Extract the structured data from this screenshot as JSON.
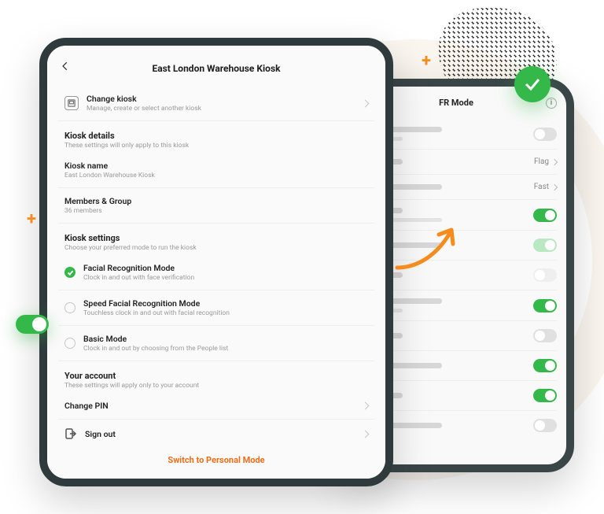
{
  "colors": {
    "accent": "#f06d1a",
    "success": "#35b84a"
  },
  "front": {
    "title": "East London Warehouse Kiosk",
    "changeKiosk": {
      "label": "Change kiosk",
      "sub": "Manage, create or select another kiosk"
    },
    "sections": {
      "details": {
        "title": "Kiosk details",
        "sub": "These settings will only apply to this kiosk"
      },
      "settings": {
        "title": "Kiosk settings",
        "sub": "Choose your preferred mode to run the kiosk"
      },
      "account": {
        "title": "Your account",
        "sub": "These settings will apply only to your account"
      }
    },
    "kioskName": {
      "label": "Kiosk name",
      "value": "East London Warehouse Kiosk"
    },
    "members": {
      "label": "Members & Group",
      "value": "36 members"
    },
    "modes": [
      {
        "label": "Facial Recognition Mode",
        "sub": "Clock in and out with face verification",
        "selected": true
      },
      {
        "label": "Speed Facial Recognition Mode",
        "sub": "Touchless clock in and out with facial recognition",
        "selected": false
      },
      {
        "label": "Basic Mode",
        "sub": "Clock in and out by choosing from the People list",
        "selected": false
      }
    ],
    "changePin": {
      "label": "Change PIN"
    },
    "signOut": {
      "label": "Sign out"
    },
    "footerButton": "Switch to Personal Mode"
  },
  "back": {
    "title": "FR Mode",
    "rows": [
      {
        "type": "toggle",
        "on": false
      },
      {
        "type": "nav",
        "value": "Flag"
      },
      {
        "type": "nav",
        "value": "Fast"
      },
      {
        "type": "toggle",
        "on": true
      },
      {
        "type": "toggle",
        "on": true,
        "faded": true
      },
      {
        "type": "toggle",
        "on": false,
        "faded": true
      },
      {
        "type": "toggle",
        "on": true
      },
      {
        "type": "toggle",
        "on": false
      },
      {
        "type": "toggle",
        "on": true
      },
      {
        "type": "toggle",
        "on": true
      },
      {
        "type": "toggle",
        "on": false
      }
    ]
  }
}
